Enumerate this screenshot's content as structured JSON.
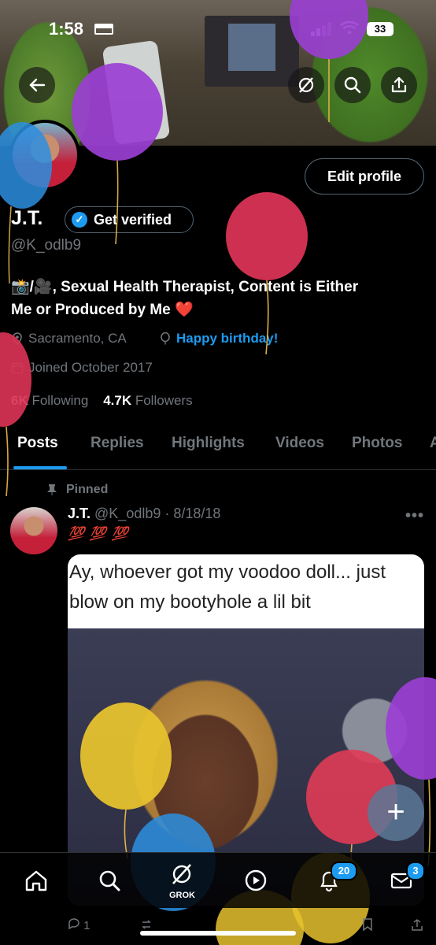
{
  "status_bar": {
    "time": "1:58",
    "battery": "33"
  },
  "profile": {
    "edit_label": "Edit profile",
    "name": "J.T.",
    "verified_label": "Get verified",
    "handle": "@K_odlb9",
    "bio_line1": "📸/🎥, Sexual Health Therapist, Content is Either",
    "bio_line2": "Me or Produced by Me ❤️",
    "location": "Sacramento, CA",
    "birthday": "Happy birthday!",
    "joined": "Joined October 2017",
    "following_count": "6K",
    "following_label": "Following",
    "followers_count": "4.7K",
    "followers_label": "Followers"
  },
  "tabs": [
    "Posts",
    "Replies",
    "Highlights",
    "Videos",
    "Photos",
    "A"
  ],
  "post": {
    "pinned_label": "Pinned",
    "author": "J.T.",
    "handle_date": "@K_odlb9 · 8/18/18",
    "text": "💯 💯 💯",
    "caption_line1": "Ay, whoever got my voodoo doll... just",
    "caption_line2": "blow on my bootyhole a lil bit",
    "reply_count": "1"
  },
  "nav": {
    "grok_label": "GROK",
    "notifications_badge": "20",
    "messages_badge": "3"
  },
  "colors": {
    "accent": "#1d9bf0",
    "background": "#000000",
    "muted": "#71767b"
  }
}
